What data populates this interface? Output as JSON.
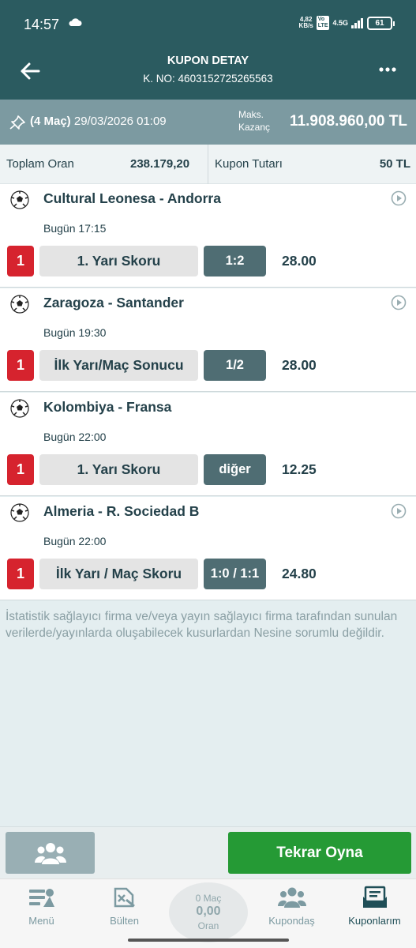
{
  "status_bar": {
    "time": "14:57",
    "speed_value": "4,82",
    "speed_unit": "KB/s",
    "chip_top": "Vo",
    "chip_bottom": "LTE",
    "network": "4.5G",
    "battery": "61"
  },
  "header": {
    "title": "KUPON DETAY",
    "coupon_no": "K. NO: 4603152725265563"
  },
  "summary": {
    "match_count": "(4 Maç)",
    "datetime": "29/03/2026 01:09",
    "max_win_label_1": "Maks.",
    "max_win_label_2": "Kazanç",
    "max_win_value": "11.908.960,00 TL"
  },
  "totals": {
    "total_odds_label": "Toplam Oran",
    "total_odds_value": "238.179,20",
    "stake_label": "Kupon Tutarı",
    "stake_value": "50 TL"
  },
  "matches": [
    {
      "title": "Cultural Leonesa - Andorra",
      "time": "Bugün 17:15",
      "pick": "1",
      "market": "1. Yarı Skoru",
      "selection": "1:2",
      "odds": "28.00"
    },
    {
      "title": "Zaragoza - Santander",
      "time": "Bugün 19:30",
      "pick": "1",
      "market": "İlk Yarı/Maç Sonucu",
      "selection": "1/2",
      "odds": "28.00"
    },
    {
      "title": "Kolombiya - Fransa",
      "time": "Bugün 22:00",
      "pick": "1",
      "market": "1. Yarı Skoru",
      "selection": "diğer",
      "odds": "12.25"
    },
    {
      "title": "Almeria - R. Sociedad B",
      "time": "Bugün 22:00",
      "pick": "1",
      "market": "İlk Yarı / Maç Skoru",
      "selection": "1:0 / 1:1",
      "odds": "24.80"
    }
  ],
  "disclaimer": "İstatistik sağlayıcı firma ve/veya yayın sağlayıcı firma tarafından sunulan verilerde/yayınlarda oluşabilecek kusurlardan Nesine sorumlu değildir.",
  "actions": {
    "replay_label": "Tekrar Oyna"
  },
  "bottom_nav": {
    "items": [
      {
        "label": "Menü",
        "icon": "menu-icon"
      },
      {
        "label": "Bülten",
        "icon": "bulletin-icon"
      },
      {
        "label": "Kupondaş",
        "icon": "kupondas-icon"
      },
      {
        "label": "Kuponlarım",
        "icon": "coupons-icon"
      }
    ],
    "center": {
      "count": "0 Maç",
      "value": "0,00",
      "label": "Oran"
    }
  },
  "colors": {
    "header_bg": "#2b5b60",
    "summary_bg": "#7c9aa1",
    "pick_red": "#d6232e",
    "selection_bg": "#4f6d73",
    "replay_green": "#259a35"
  }
}
